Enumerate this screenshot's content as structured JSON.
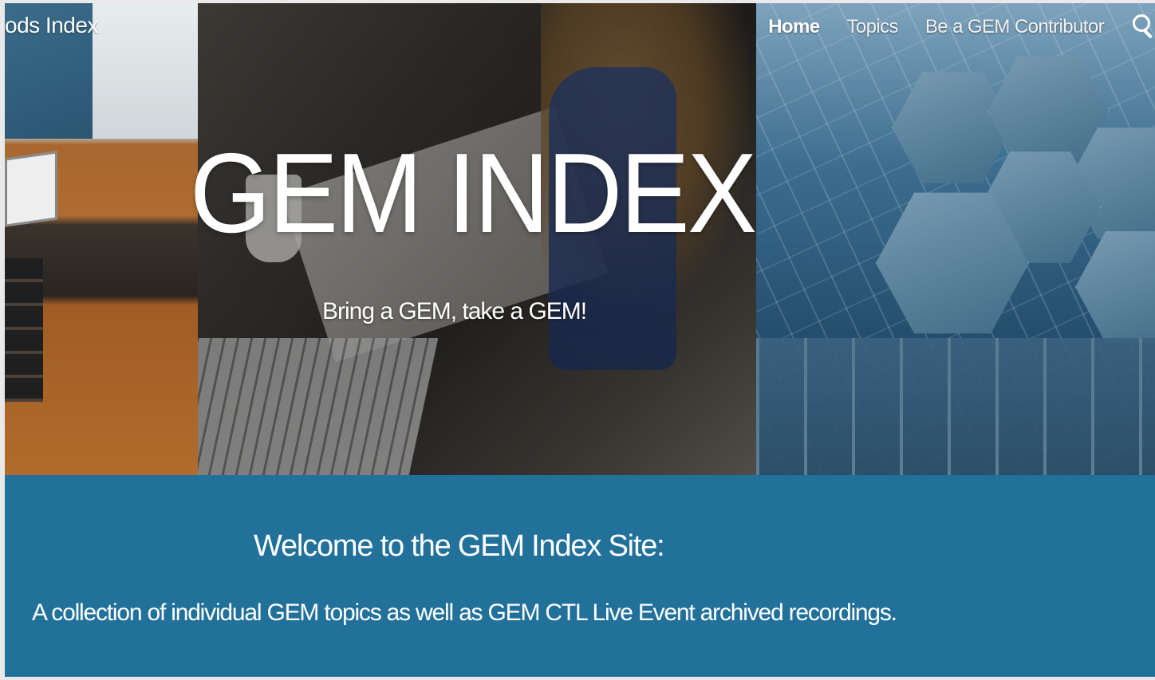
{
  "site": {
    "title": "ods Index"
  },
  "nav": {
    "items": [
      {
        "label": "Home",
        "active": true
      },
      {
        "label": "Topics",
        "active": false
      },
      {
        "label": "Be a GEM Contributor",
        "active": false
      }
    ],
    "search_icon": "search-icon"
  },
  "hero": {
    "title": "GEM INDEX",
    "tagline": "Bring a GEM, take a GEM!"
  },
  "welcome": {
    "heading": "Welcome to the GEM Index Site:",
    "description": "A collection of individual GEM topics as well as GEM CTL Live Event archived recordings."
  },
  "colors": {
    "welcome_band": "#22719b",
    "text": "#ffffff"
  }
}
